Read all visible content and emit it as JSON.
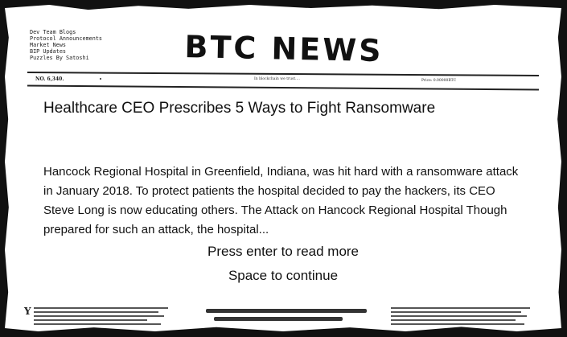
{
  "menu": [
    "Dev Team Blogs",
    "Protocol Announcements",
    "Market News",
    "BIP Updates",
    "Puzzles By Satoshi"
  ],
  "masthead": "BTC NEWS",
  "strip": {
    "issue": "NO. 6,340.",
    "center": "In blockchain we trust....",
    "price": "Price: 0.00000BTC"
  },
  "article": {
    "headline": "Healthcare CEO Prescribes 5 Ways to Fight Ransomware",
    "excerpt": "Hancock Regional Hospital in Greenfield, Indiana, was hit hard with a ransomware attack in January 2018. To protect patients the hospital decided to pay the hackers, its CEO Steve Long is now educating others. The Attack on Hancock Regional Hospital Though prepared for such an attack, the hospital..."
  },
  "prompts": {
    "enter": "Press enter to read more",
    "space": "Space to continue"
  }
}
